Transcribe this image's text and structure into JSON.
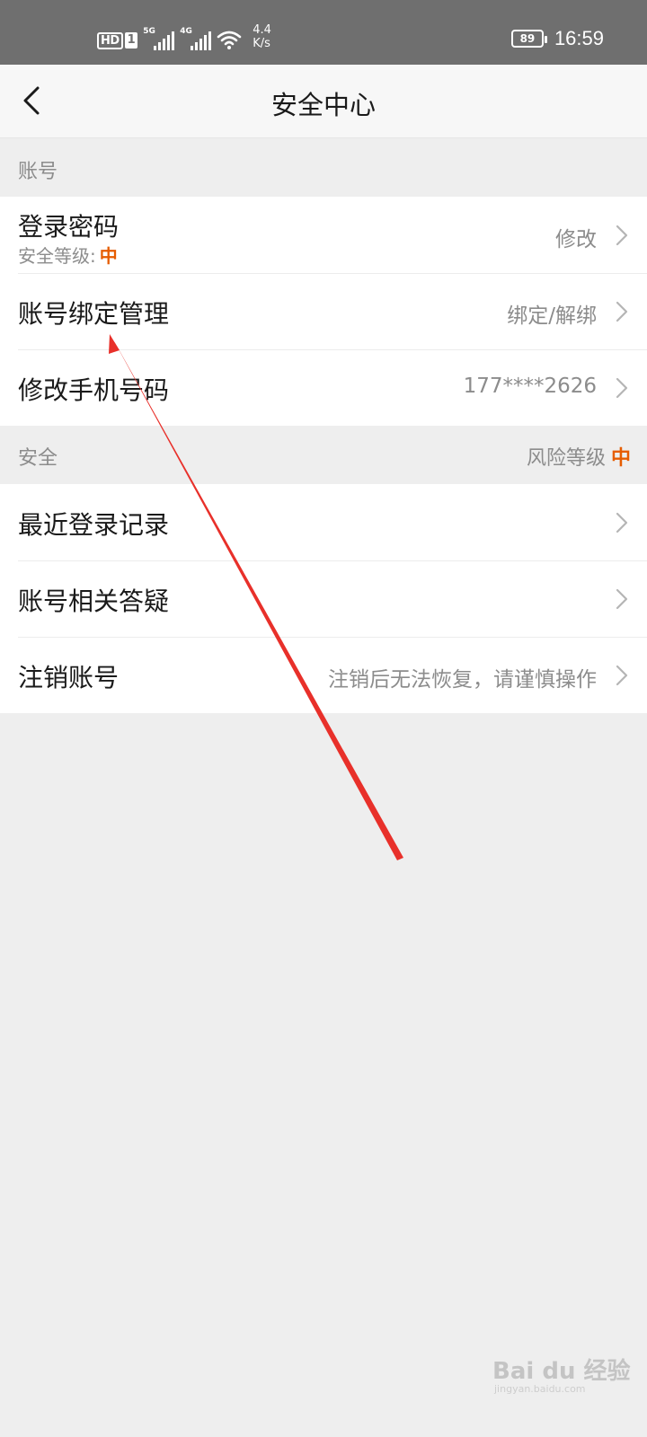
{
  "status_bar": {
    "hd": "HD",
    "sim": "1",
    "net1": "5G",
    "net2": "4G",
    "speed_value": "4.4",
    "speed_unit": "K/s",
    "battery": "89",
    "time": "16:59"
  },
  "header": {
    "title": "安全中心"
  },
  "account_section": {
    "label": "账号",
    "items": [
      {
        "title": "登录密码",
        "sub_label": "安全等级:",
        "sub_level": "中",
        "value": "修改"
      },
      {
        "title": "账号绑定管理",
        "value": "绑定/解绑"
      },
      {
        "title": "修改手机号码",
        "value": "177****2626"
      }
    ]
  },
  "security_section": {
    "label": "安全",
    "risk_label": "风险等级",
    "risk_level": "中",
    "items": [
      {
        "title": "最近登录记录",
        "value": ""
      },
      {
        "title": "账号相关答疑",
        "value": ""
      },
      {
        "title": "注销账号",
        "value": "注销后无法恢复，请谨慎操作"
      }
    ]
  },
  "watermark": {
    "text": "Bai du 经验",
    "url": "jingyan.baidu.com"
  },
  "colors": {
    "accent": "#e65c00",
    "arrow": "#e8302a",
    "background": "#eeeeee",
    "status_bar": "#6f6f6f"
  }
}
